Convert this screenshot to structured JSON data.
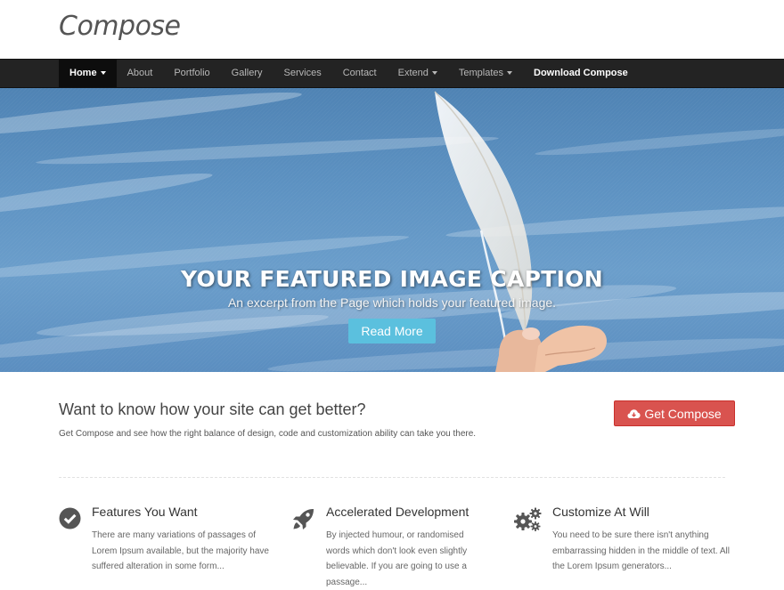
{
  "site": {
    "logo": "Compose"
  },
  "nav": {
    "items": [
      {
        "label": "Home"
      },
      {
        "label": "About"
      },
      {
        "label": "Portfolio"
      },
      {
        "label": "Gallery"
      },
      {
        "label": "Services"
      },
      {
        "label": "Contact"
      },
      {
        "label": "Extend"
      },
      {
        "label": "Templates"
      },
      {
        "label": "Download Compose"
      }
    ]
  },
  "hero": {
    "title": "YOUR FEATURED IMAGE CAPTION",
    "subtitle": "An excerpt from the Page which holds your featured image.",
    "button": "Read More"
  },
  "cta": {
    "heading": "Want to know how your site can get better?",
    "text": "Get Compose and see how the right balance of design, code and customization ability can take you there.",
    "button": "Get Compose"
  },
  "features": [
    {
      "icon": "check-circle-icon",
      "title": "Features You Want",
      "text": "There are many variations of passages of Lorem Ipsum available, but the majority have suffered alteration in some form..."
    },
    {
      "icon": "rocket-icon",
      "title": "Accelerated Development",
      "text": "By injected humour, or randomised words which don't look even slightly believable. If you are going to use a passage..."
    },
    {
      "icon": "gears-icon",
      "title": "Customize At Will",
      "text": "You need to be sure there isn't anything embarrassing hidden in the middle of text. All the Lorem Ipsum generators..."
    }
  ],
  "colors": {
    "nav_bg": "#232323",
    "hero_button": "#5bc0de",
    "cta_button": "#d9534f",
    "sky": "#5d92c2"
  }
}
